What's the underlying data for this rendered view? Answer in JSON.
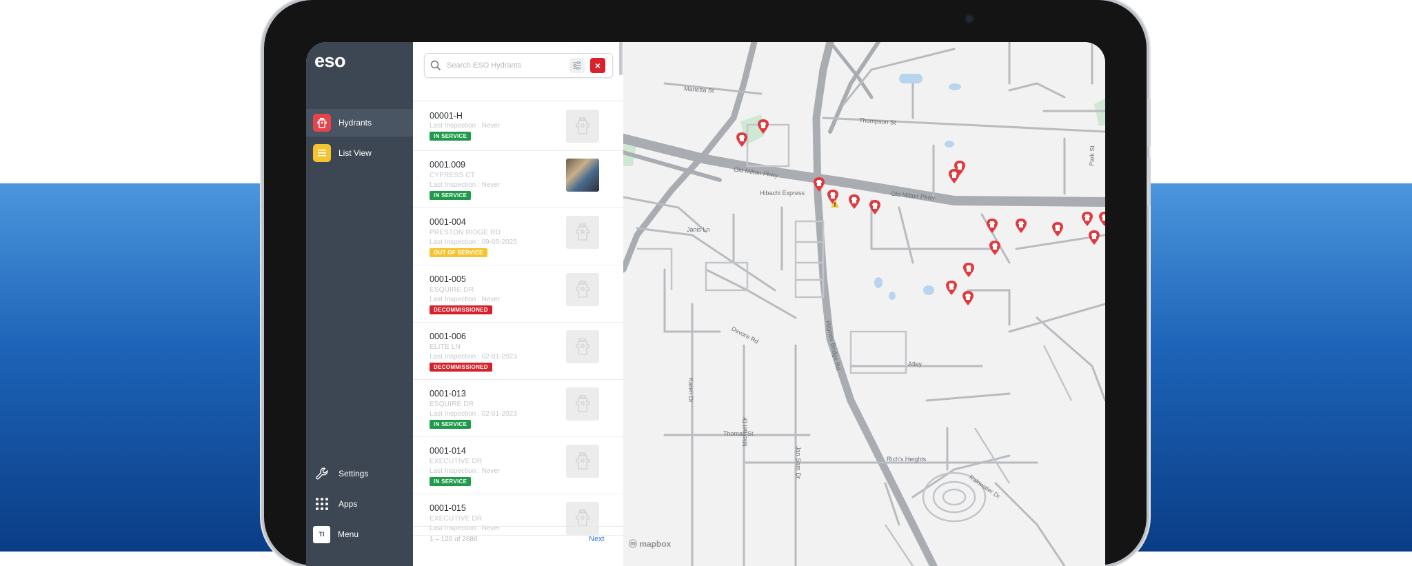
{
  "app": {
    "logo": "eso"
  },
  "nav": {
    "hydrants": "Hydrants",
    "list_view": "List View",
    "settings": "Settings",
    "apps": "Apps",
    "menu": "Menu",
    "menu_avatar": "TI"
  },
  "search": {
    "placeholder": "Search ESO Hydrants",
    "close": "×"
  },
  "hydrants": [
    {
      "id": "00001-H",
      "street": "",
      "inspection": "Last Inspection : Never",
      "status": "IN SERVICE",
      "status_color": "#1f9a4a",
      "photo": false
    },
    {
      "id": "0001.009",
      "street": "CYPRESS CT",
      "inspection": "Last Inspection : Never",
      "status": "IN SERVICE",
      "status_color": "#1f9a4a",
      "photo": true
    },
    {
      "id": "0001-004",
      "street": "PRESTON RIDGE RD",
      "inspection": "Last Inspection : 09-05-2025",
      "status": "OUT OF SERVICE",
      "status_color": "#f5c431",
      "photo": false
    },
    {
      "id": "0001-005",
      "street": "ESQUIRE DR",
      "inspection": "Last Inspection : Never",
      "status": "DECOMMISSIONED",
      "status_color": "#d6222a",
      "photo": false
    },
    {
      "id": "0001-006",
      "street": "ELITE LN",
      "inspection": "Last Inspection : 02-01-2023",
      "status": "DECOMMISSIONED",
      "status_color": "#d6222a",
      "photo": false
    },
    {
      "id": "0001-013",
      "street": "ESQUIRE DR",
      "inspection": "Last Inspection : 02-01-2023",
      "status": "IN SERVICE",
      "status_color": "#1f9a4a",
      "photo": false
    },
    {
      "id": "0001-014",
      "street": "EXECUTIVE DR",
      "inspection": "Last Inspection : Never",
      "status": "IN SERVICE",
      "status_color": "#1f9a4a",
      "photo": false
    },
    {
      "id": "0001-015",
      "street": "EXECUTIVE DR",
      "inspection": "Last Inspection : Never",
      "status": "",
      "status_color": "",
      "photo": false
    }
  ],
  "pager": {
    "count": "1 – 120 of 2686",
    "next": "Next"
  },
  "map": {
    "attribution": "mapbox",
    "labels": {
      "marietta": "Marietta St",
      "thompson": "Thompson St",
      "old_milton_1": "Old Milton Pkwy",
      "old_milton_2": "Old Milton Pkwy",
      "hibachi": "Hibachi Express",
      "janis": "Janis Ln",
      "haynes": "Haynes Bridge Rd",
      "devore": "Devore Rd",
      "karen": "Karen Dr",
      "michael": "Michael Dr",
      "thomas": "Thomas St",
      "jan_sam": "Jan Sam Dr",
      "atley": "Atley",
      "rainwater": "Rainwater Dr",
      "park": "Park St",
      "heights": "Rich's Heights"
    }
  },
  "colors": {
    "accent_red": "#d6222a",
    "sidebar": "#3d4754",
    "in_service": "#1f9a4a",
    "out_of_service": "#f5c431"
  }
}
